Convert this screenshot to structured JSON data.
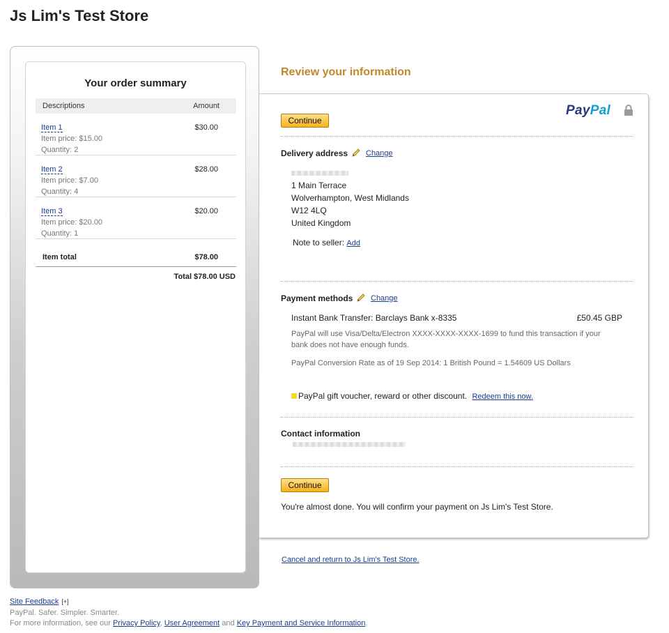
{
  "store": {
    "title": "Js Lim's Test Store"
  },
  "summary": {
    "title": "Your order summary",
    "col_descriptions": "Descriptions",
    "col_amount": "Amount",
    "items": [
      {
        "name": "Item 1",
        "amount": "$30.00",
        "price": "Item price: $15.00",
        "quantity": "Quantity: 2"
      },
      {
        "name": "Item 2",
        "amount": "$28.00",
        "price": "Item price: $7.00",
        "quantity": "Quantity: 4"
      },
      {
        "name": "Item 3",
        "amount": "$20.00",
        "price": "Item price: $20.00",
        "quantity": "Quantity: 1"
      }
    ],
    "item_total_label": "Item total",
    "item_total_value": "$78.00",
    "total": "Total $78.00 USD"
  },
  "review": {
    "title": "Review your information",
    "logo_pay": "Pay",
    "logo_pal": "Pal",
    "continue_label": "Continue",
    "delivery": {
      "heading": "Delivery address",
      "change": "Change",
      "lines": [
        "1 Main Terrace",
        "Wolverhampton, West Midlands",
        "W12 4LQ",
        "United Kingdom"
      ],
      "note_label": "Note to seller:",
      "note_add": "Add"
    },
    "payment": {
      "heading": "Payment methods",
      "change": "Change",
      "method": "Instant Bank Transfer: Barclays Bank x-8335",
      "amount": "£50.45 GBP",
      "fund_note": "PayPal will use Visa/Delta/Electron XXXX-XXXX-XXXX-1699 to fund this transaction if your bank does not have enough funds.",
      "conversion": "PayPal Conversion Rate as of 19 Sep 2014: 1 British Pound = 1.54609 US Dollars",
      "voucher": "PayPal gift voucher, reward or other discount.",
      "redeem": "Redeem this now."
    },
    "contact": {
      "heading": "Contact information"
    },
    "done_text": "You're almost done. You will confirm your payment on Js Lim's Test Store.",
    "cancel": "Cancel and return to Js Lim's Test Store."
  },
  "footer": {
    "feedback": "Site Feedback",
    "expander": "[+]",
    "tagline": "PayPal. Safer. Simpler. Smarter.",
    "more_info": "For more information, see our",
    "privacy": "Privacy Policy",
    "comma": ",",
    "agreement": "User Agreement",
    "and": "and",
    "key_info": "Key Payment and Service Information",
    "period": "."
  }
}
